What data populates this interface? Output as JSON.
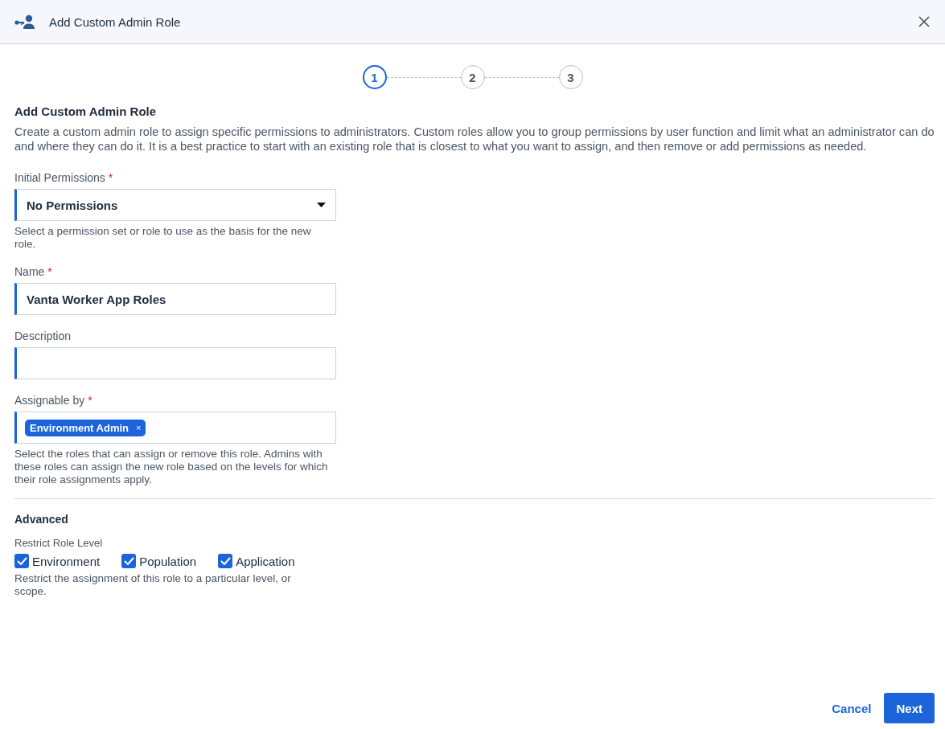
{
  "window": {
    "title": "Add Custom Admin Role"
  },
  "steps": [
    {
      "label": "1",
      "selected": true
    },
    {
      "label": "2",
      "selected": false
    },
    {
      "label": "3",
      "selected": false
    }
  ],
  "form": {
    "title": "Add Custom Admin Role",
    "description": "Create a custom admin role to assign specific permissions to administrators. Custom roles allow you to group permissions by user function and limit what an administrator can do and where they can do it. It is a best practice to start with an existing role that is closest to what you want to assign, and then remove or add permissions as needed.",
    "fields": [
      {
        "kind": "select",
        "label": "Initial Permissions",
        "required_mark": "*",
        "value": "No Permissions",
        "help": "Select a permission set or role to use as the basis for the new role."
      },
      {
        "kind": "text",
        "label": "Name",
        "required_mark": "*",
        "value": "Vanta Worker App Roles"
      },
      {
        "kind": "text",
        "label": "Description"
      },
      {
        "kind": "tags",
        "label": "Assignable by",
        "required_mark": "*",
        "tags": [
          {
            "label": "Environment Admin",
            "remove": "×"
          }
        ],
        "help": "Select the roles that can assign or remove this role. Admins with these roles can assign the new role based on the levels for which their role assignments apply."
      }
    ]
  },
  "advanced": {
    "title": "Advanced",
    "label": "Restrict Role Level",
    "options": [
      {
        "label": "Environment",
        "checked": true
      },
      {
        "label": "Population",
        "checked": true
      },
      {
        "label": "Application",
        "checked": true
      }
    ],
    "help": "Restrict the assignment of this role to a particular level, or scope."
  },
  "buttons": [
    {
      "kind": "link",
      "label": "Cancel"
    },
    {
      "kind": "primary",
      "label": "Next"
    }
  ]
}
